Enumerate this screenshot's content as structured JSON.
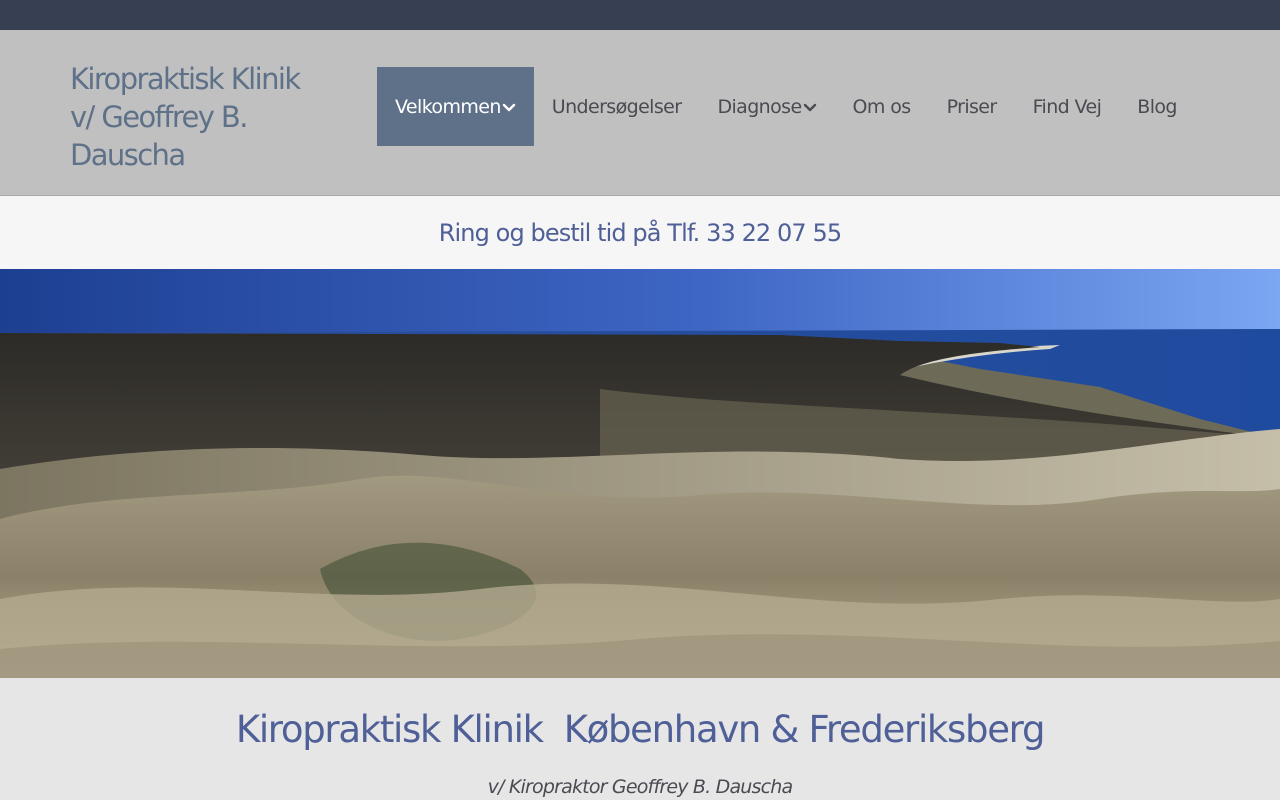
{
  "header": {
    "site_title": "Kiropraktisk Klinik v/ Geoffrey B. Dauscha"
  },
  "nav": {
    "items": [
      {
        "label": "Velkommen",
        "has_dropdown": true,
        "active": true
      },
      {
        "label": "Undersøgelser",
        "has_dropdown": false,
        "active": false
      },
      {
        "label": "Diagnose",
        "has_dropdown": true,
        "active": false
      },
      {
        "label": "Om os",
        "has_dropdown": false,
        "active": false
      },
      {
        "label": "Priser",
        "has_dropdown": false,
        "active": false
      },
      {
        "label": "Find Vej",
        "has_dropdown": false,
        "active": false
      },
      {
        "label": "Blog",
        "has_dropdown": false,
        "active": false
      }
    ]
  },
  "call_bar": {
    "text": "Ring og bestil tid på Tlf. 33 22 07 55"
  },
  "hero": {
    "image_subject": "coastal dunes with grass, heathland and sea"
  },
  "intro": {
    "heading": "Kiropraktisk Klinik  København & Frederiksberg",
    "subheading": "v/ Kiropraktor Geoffrey B. Dauscha"
  },
  "colors": {
    "top_strip": "#373f52",
    "header_bg": "#c0c0c0",
    "brand_text": "#5e7189",
    "nav_active_bg": "#5e7189",
    "accent_text": "#4f5f97",
    "call_bar_bg": "#f6f6f6",
    "page_bg": "#e6e6e6"
  }
}
